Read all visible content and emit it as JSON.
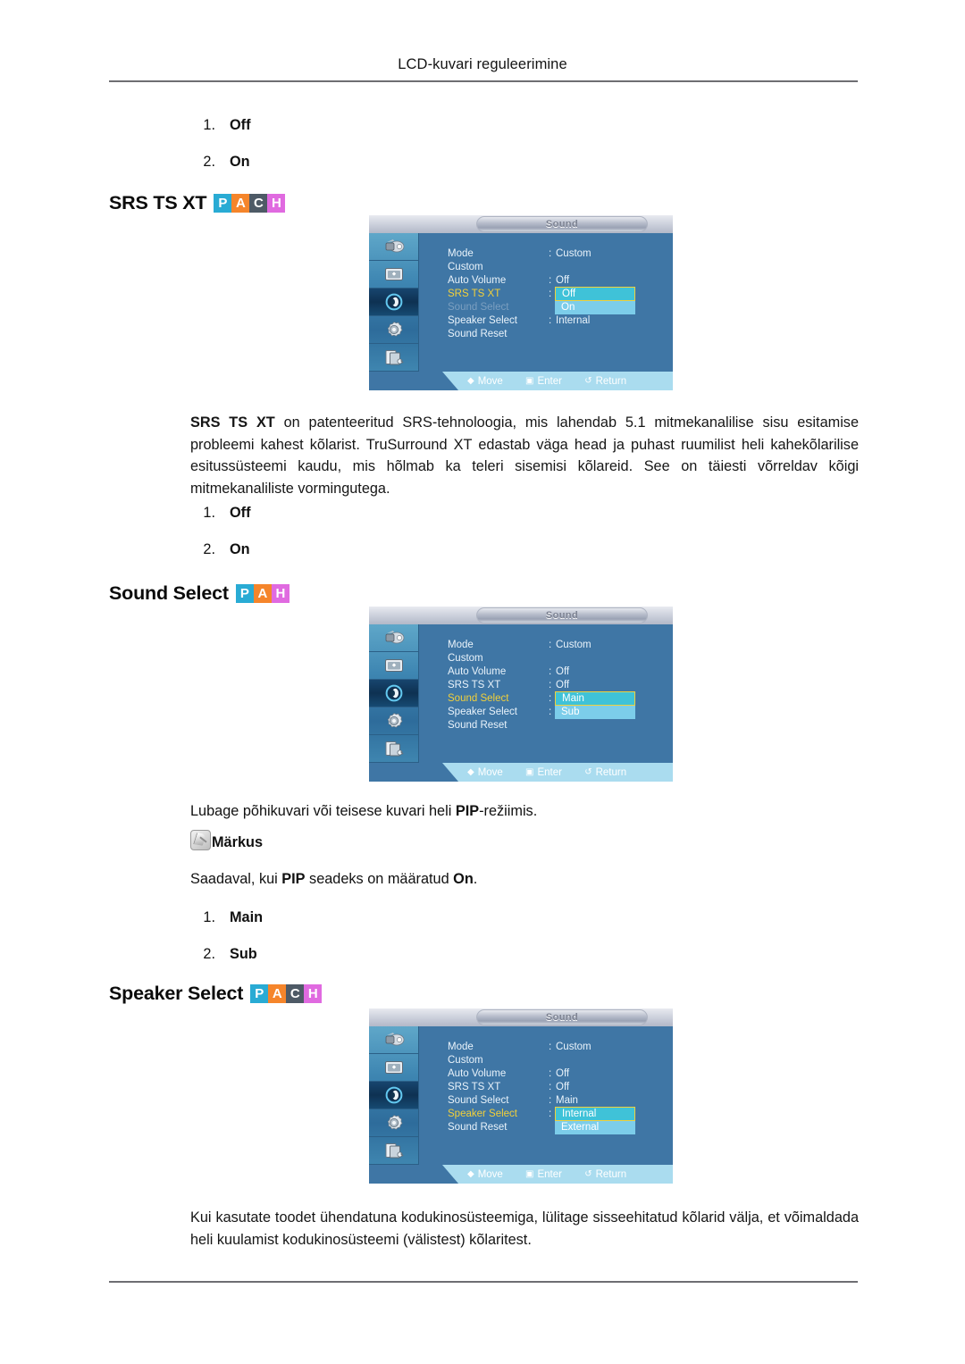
{
  "header": {
    "title": "LCD-kuvari reguleerimine"
  },
  "list_top": {
    "items": [
      {
        "num": "1.",
        "value": "Off"
      },
      {
        "num": "2.",
        "value": "On"
      }
    ]
  },
  "sections": [
    {
      "id": "srs-ts-xt",
      "heading": "SRS TS XT",
      "badges": [
        "P",
        "A",
        "C",
        "H"
      ],
      "paragraph_lead": "SRS TS XT",
      "paragraph_rest": " on patenteeritud SRS-tehnoloogia, mis lahendab 5.1 mitmekanalilise sisu esitamise probleemi kahest kõlarist. TruSurround XT edastab väga head ja puhast ruumilist heli kahekõlarilise esitussüsteemi kaudu, mis hõlmab ka teleri sisemisi kõlareid. See on täiesti võrreldav kõigi mitmekanaliliste vormingutega.",
      "options": [
        {
          "num": "1.",
          "value": "Off"
        },
        {
          "num": "2.",
          "value": "On"
        }
      ]
    },
    {
      "id": "sound-select",
      "heading": "Sound Select",
      "badges": [
        "P",
        "A",
        "H"
      ],
      "options": [
        {
          "num": "1.",
          "value": "Main"
        },
        {
          "num": "2.",
          "value": "Sub"
        }
      ]
    },
    {
      "id": "speaker-select",
      "heading": "Speaker Select",
      "badges": [
        "P",
        "A",
        "C",
        "H"
      ],
      "options": []
    }
  ],
  "note": {
    "intro_a": "Lubage põhikuvari või teisese kuvari heli ",
    "intro_b": "PIP",
    "intro_c": "-režiimis.",
    "label": "Märkus",
    "body_a": "Saadaval, kui ",
    "body_b": "PIP",
    "body_c": " seadeks on määratud ",
    "body_d": "On",
    "body_e": "."
  },
  "closing_paragraph": "Kui kasutate toodet ühendatuna kodukinosüsteemiga, lülitage sisseehitatud kõlarid välja, et võimaldada heli kuulamist kodukinosüsteemi (välistest) kõlaritest.",
  "osd": {
    "title": "Sound",
    "hints": [
      {
        "glyph": "◆",
        "label": "Move"
      },
      {
        "glyph": "▣",
        "label": "Enter"
      },
      {
        "glyph": "↺",
        "label": "Return"
      }
    ],
    "sidebar_icons": [
      "picture-icon",
      "screen-icon",
      "sound-icon",
      "setup-icon",
      "multicontrol-icon"
    ],
    "menu_1": {
      "rows": [
        {
          "label": "Mode",
          "colon": ":",
          "value": "Custom",
          "state": "normal"
        },
        {
          "label": "Custom",
          "colon": "",
          "value": "",
          "state": "normal"
        },
        {
          "label": "Auto Volume",
          "colon": ":",
          "value": "Off",
          "state": "normal"
        },
        {
          "label": "SRS TS XT",
          "colon": ":",
          "value": "",
          "state": "selected"
        },
        {
          "label": "Sound Select",
          "colon": "",
          "value": "",
          "state": "disabled"
        },
        {
          "label": "Speaker Select",
          "colon": ":",
          "value": "Internal",
          "state": "normal"
        },
        {
          "label": "Sound Reset",
          "colon": "",
          "value": "",
          "state": "normal"
        }
      ],
      "dropdown": {
        "current": "Off",
        "alt": "On"
      }
    },
    "menu_2": {
      "rows": [
        {
          "label": "Mode",
          "colon": ":",
          "value": "Custom",
          "state": "normal"
        },
        {
          "label": "Custom",
          "colon": "",
          "value": "",
          "state": "normal"
        },
        {
          "label": "Auto Volume",
          "colon": ":",
          "value": "Off",
          "state": "normal"
        },
        {
          "label": "SRS TS XT",
          "colon": ":",
          "value": "Off",
          "state": "normal"
        },
        {
          "label": "Sound Select",
          "colon": ":",
          "value": "",
          "state": "selected"
        },
        {
          "label": "Speaker Select",
          "colon": ":",
          "value": "",
          "state": "normal"
        },
        {
          "label": "Sound Reset",
          "colon": "",
          "value": "",
          "state": "normal"
        }
      ],
      "dropdown": {
        "current": "Main",
        "alt": "Sub"
      }
    },
    "menu_3": {
      "rows": [
        {
          "label": "Mode",
          "colon": ":",
          "value": "Custom",
          "state": "normal"
        },
        {
          "label": "Custom",
          "colon": "",
          "value": "",
          "state": "normal"
        },
        {
          "label": "Auto Volume",
          "colon": ":",
          "value": "Off",
          "state": "normal"
        },
        {
          "label": "SRS TS XT",
          "colon": ":",
          "value": "Off",
          "state": "normal"
        },
        {
          "label": "Sound Select",
          "colon": ":",
          "value": "Main",
          "state": "normal"
        },
        {
          "label": "Speaker Select",
          "colon": ":",
          "value": "",
          "state": "selected"
        },
        {
          "label": "Sound Reset",
          "colon": "",
          "value": "",
          "state": "normal"
        }
      ],
      "dropdown": {
        "current": "Internal",
        "alt": "External"
      }
    }
  },
  "colors": {
    "badge_p": "#29abd4",
    "badge_a": "#f5852b",
    "badge_c": "#4e5a66",
    "badge_h": "#e06ae0",
    "osd_bg": "#3f76a5",
    "osd_selected_label": "#f2d03a",
    "osd_dropdown_current": "#3fc2d8",
    "osd_dropdown_alt": "#7ccdea",
    "osd_footer": "#aadcef"
  }
}
